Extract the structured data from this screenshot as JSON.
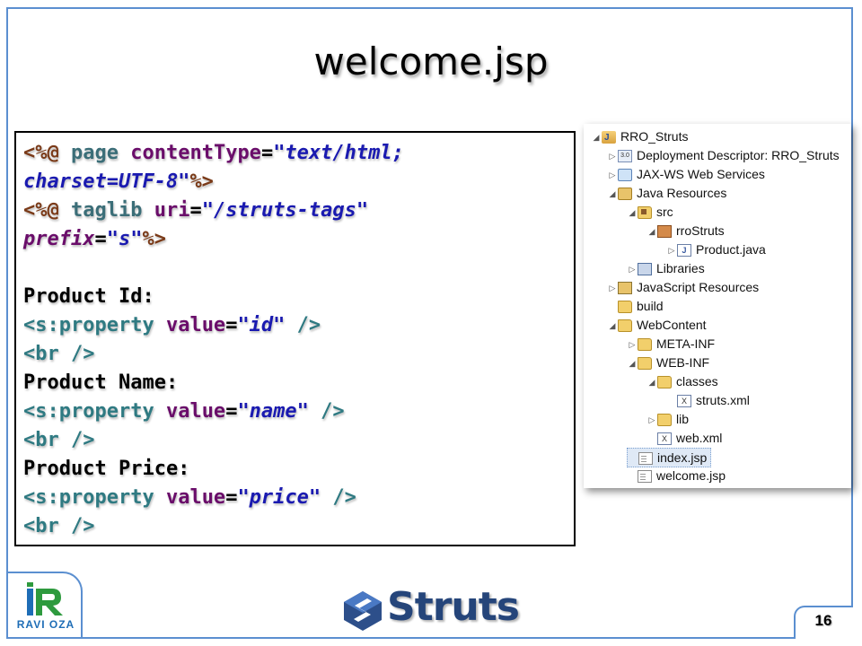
{
  "slide": {
    "title": "welcome.jsp",
    "page_number": "16"
  },
  "code": {
    "line1": {
      "t1": "<%@",
      "t2": " page ",
      "t3": "contentType",
      "t4": "=",
      "t5": "\"text/html;"
    },
    "line2": {
      "t1": "charset=UTF-8\"",
      "t2": "%>"
    },
    "line3": {
      "t1": "<%@",
      "t2": " taglib ",
      "t3": "uri",
      "t4": "=",
      "t5": "\"/struts-tags\""
    },
    "line4": {
      "t1": "prefix",
      "t2": "=",
      "t3": "\"s\"",
      "t4": "%>"
    },
    "line6": "Product Id:",
    "line7": {
      "t1": "<s:property ",
      "t2": "value",
      "t3": "=",
      "t4": "\"id\"",
      "t5": " />"
    },
    "line8": "<br />",
    "line9": "Product Name:",
    "line10": {
      "t1": "<s:property ",
      "t2": "value",
      "t3": "=",
      "t4": "\"name\"",
      "t5": " />"
    },
    "line11": "<br />",
    "line12": "Product Price:",
    "line13": {
      "t1": "<s:property ",
      "t2": "value",
      "t3": "=",
      "t4": "\"price\"",
      "t5": " />"
    },
    "line14": "<br />"
  },
  "tree": {
    "items": [
      {
        "label": "RRO_Struts",
        "twisty": "◢",
        "icon": "project-icon"
      },
      {
        "label": "Deployment Descriptor: RRO_Struts",
        "twisty": "▷",
        "icon": "deployment-descriptor-icon"
      },
      {
        "label": "JAX-WS Web Services",
        "twisty": "▷",
        "icon": "web-services-icon"
      },
      {
        "label": "Java Resources",
        "twisty": "◢",
        "icon": "java-resources-icon"
      },
      {
        "label": "src",
        "twisty": "◢",
        "icon": "source-folder-icon"
      },
      {
        "label": "rroStruts",
        "twisty": "◢",
        "icon": "package-icon"
      },
      {
        "label": "Product.java",
        "twisty": "▷",
        "icon": "java-file-icon"
      },
      {
        "label": "Libraries",
        "twisty": "▷",
        "icon": "libraries-icon"
      },
      {
        "label": "JavaScript Resources",
        "twisty": "▷",
        "icon": "javascript-resources-icon"
      },
      {
        "label": "build",
        "twisty": "",
        "icon": "folder-icon"
      },
      {
        "label": "WebContent",
        "twisty": "◢",
        "icon": "folder-icon"
      },
      {
        "label": "META-INF",
        "twisty": "▷",
        "icon": "folder-icon"
      },
      {
        "label": "WEB-INF",
        "twisty": "◢",
        "icon": "folder-icon"
      },
      {
        "label": "classes",
        "twisty": "◢",
        "icon": "folder-icon"
      },
      {
        "label": "struts.xml",
        "twisty": "",
        "icon": "xml-file-icon"
      },
      {
        "label": "lib",
        "twisty": "▷",
        "icon": "folder-icon"
      },
      {
        "label": "web.xml",
        "twisty": "",
        "icon": "xml-file-icon"
      },
      {
        "label": "index.jsp",
        "twisty": "",
        "icon": "jsp-file-icon"
      },
      {
        "label": "welcome.jsp",
        "twisty": "",
        "icon": "jsp-file-icon"
      }
    ]
  },
  "footer": {
    "logo_text": "RAVI OZA",
    "brand": "Struts"
  },
  "colors": {
    "frame": "#5b8fd0",
    "directive": "#7a3a18",
    "keyword": "#3b6e78",
    "attribute": "#6a0d6a",
    "string": "#1a1ab0",
    "tag": "#2f7a82",
    "brand": "#25457a",
    "logo": "#1e6db6"
  }
}
